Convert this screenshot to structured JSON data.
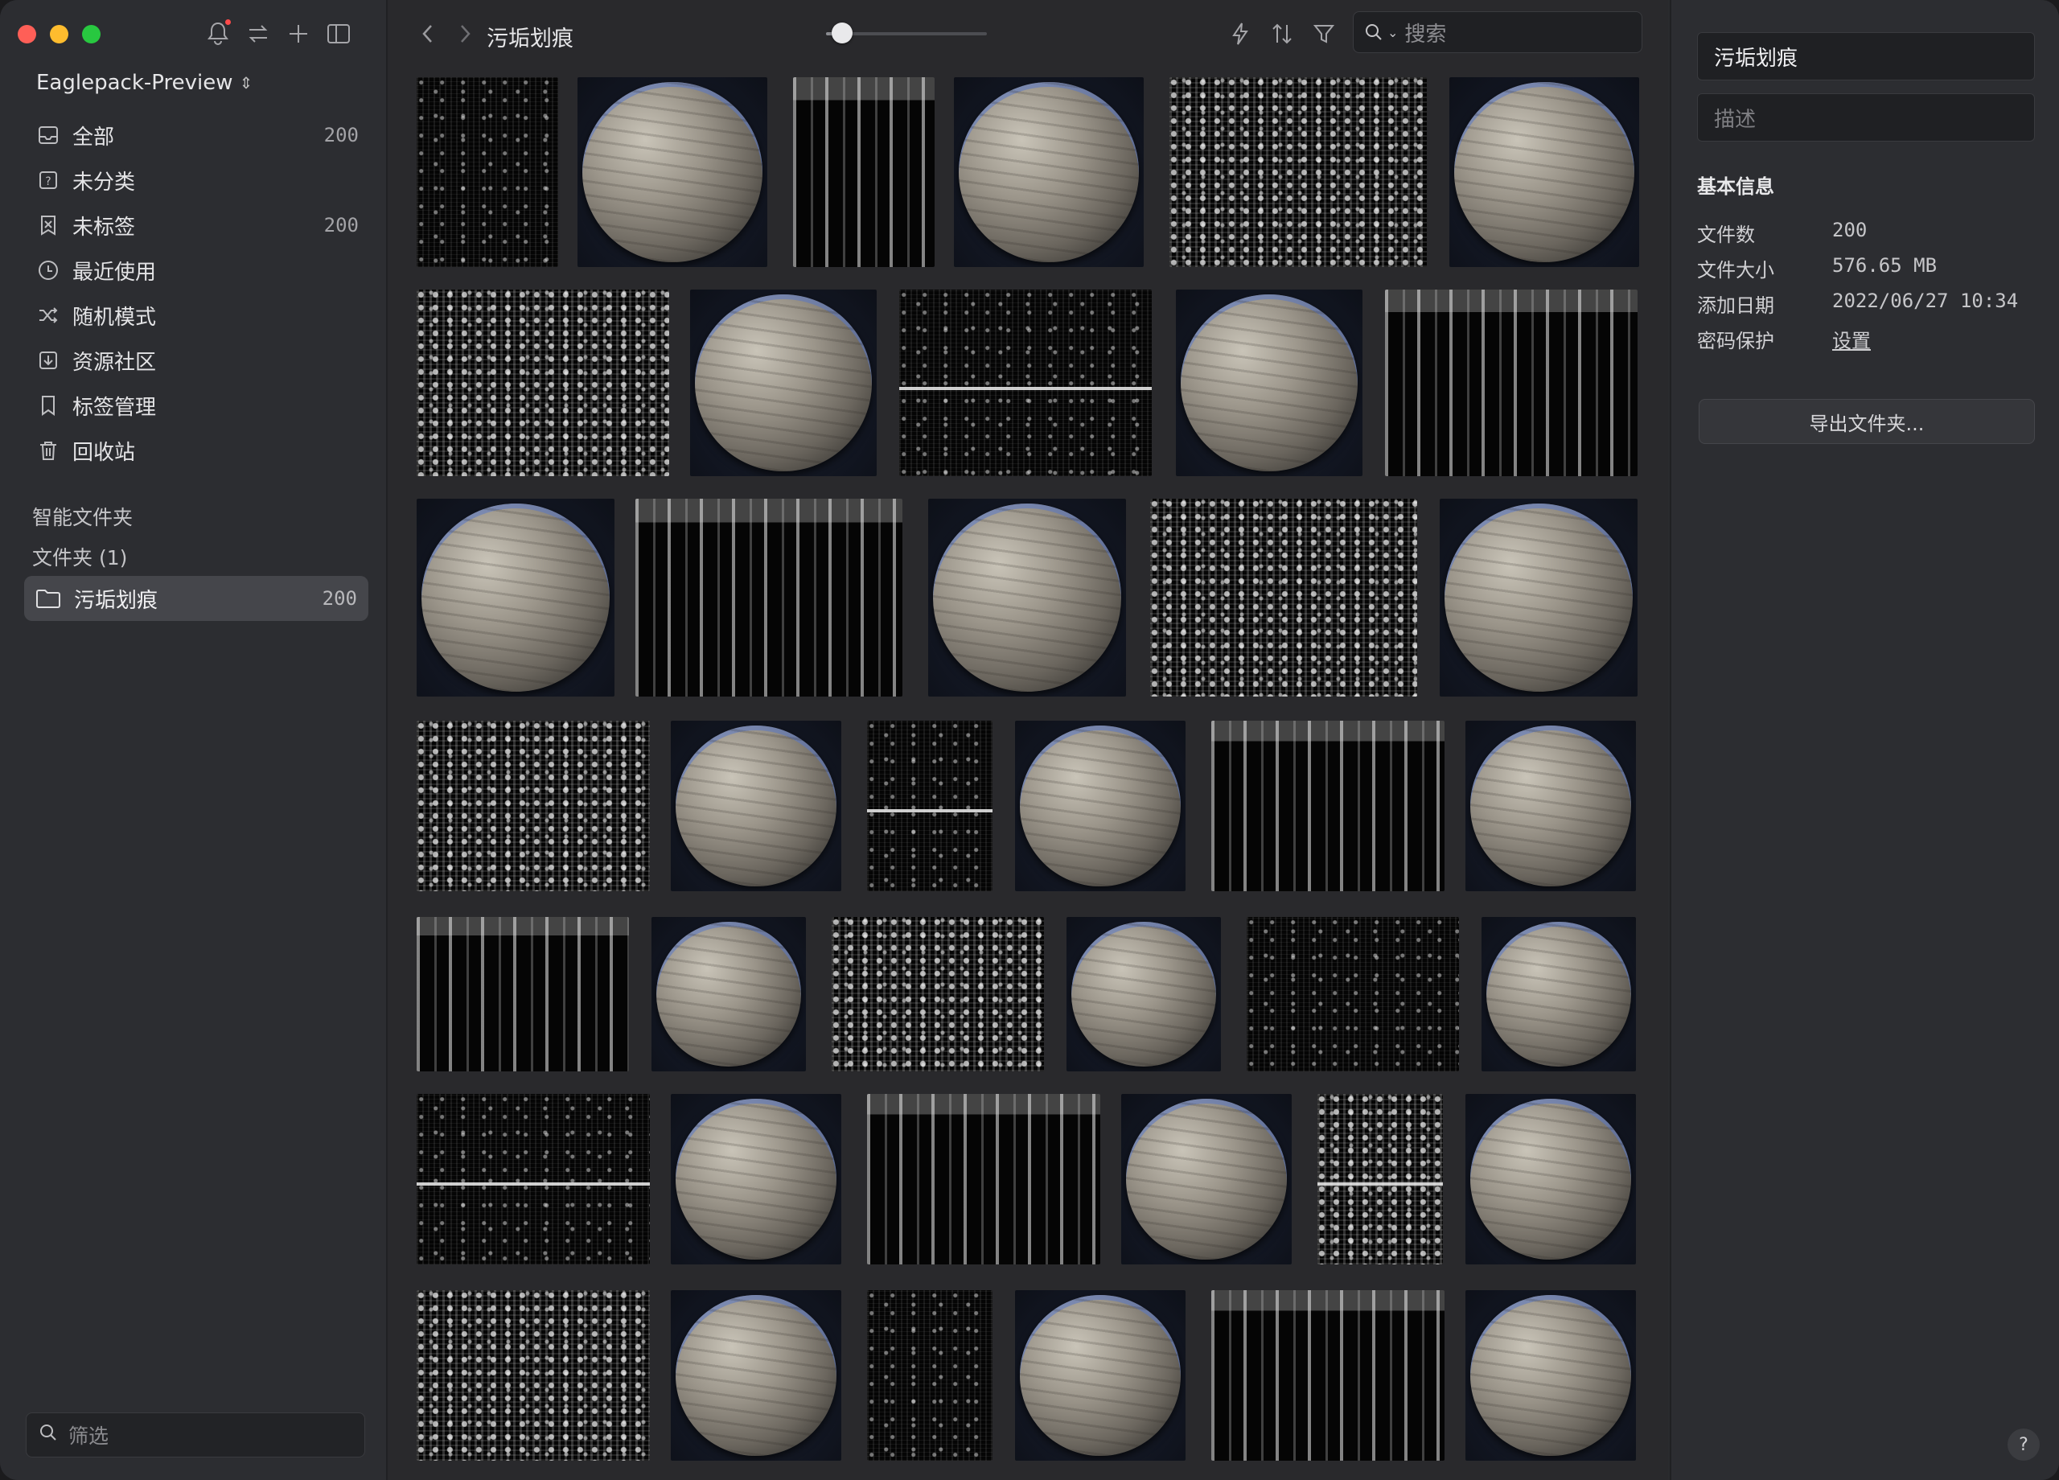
{
  "window": {
    "traffic_lights": {
      "close": "#fe5f57",
      "minimize": "#febc2e",
      "zoom": "#28c840"
    }
  },
  "sidebar": {
    "library_name": "Eaglepack-Preview",
    "items": [
      {
        "label": "全部",
        "count": "200",
        "icon": "inbox-icon"
      },
      {
        "label": "未分类",
        "count": "",
        "icon": "question-box-icon"
      },
      {
        "label": "未标签",
        "count": "200",
        "icon": "tag-off-icon"
      },
      {
        "label": "最近使用",
        "count": "",
        "icon": "clock-icon"
      },
      {
        "label": "随机模式",
        "count": "",
        "icon": "shuffle-icon"
      },
      {
        "label": "资源社区",
        "count": "",
        "icon": "download-box-icon"
      },
      {
        "label": "标签管理",
        "count": "",
        "icon": "bookmark-icon"
      },
      {
        "label": "回收站",
        "count": "",
        "icon": "trash-icon"
      }
    ],
    "smart_folders_label": "智能文件夹",
    "folders_label": "文件夹 (1)",
    "folder": {
      "label": "污垢划痕",
      "count": "200"
    },
    "filter_placeholder": "筛选"
  },
  "toolbar": {
    "breadcrumb": "污垢划痕",
    "zoom_level": 0.1,
    "search_placeholder": "搜索"
  },
  "inspector": {
    "name_value": "污垢划痕",
    "description_placeholder": "描述",
    "section_title": "基本信息",
    "rows": [
      {
        "key": "文件数",
        "value": "200"
      },
      {
        "key": "文件大小",
        "value": "576.65 MB"
      },
      {
        "key": "添加日期",
        "value": "2022/06/27 10:34"
      },
      {
        "key": "密码保护",
        "value": "设置"
      }
    ],
    "export_label": "导出文件夹...",
    "help_label": "?"
  },
  "accent": "#45464b"
}
